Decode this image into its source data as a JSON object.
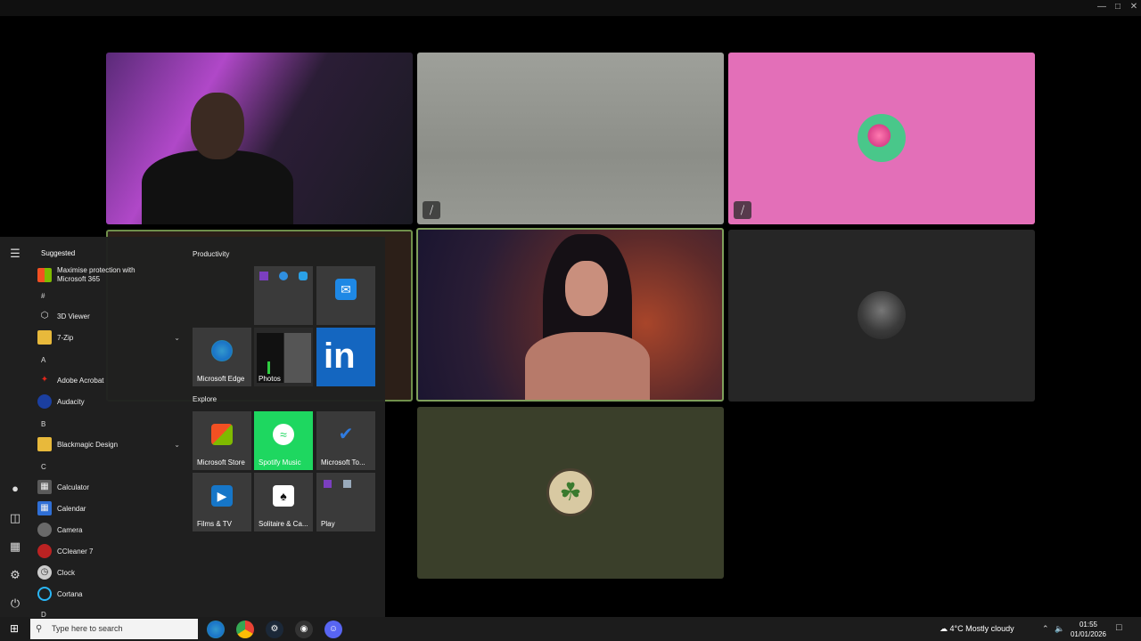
{
  "participants": [
    {
      "id": "p1",
      "muted": false
    },
    {
      "id": "p2",
      "muted": true
    },
    {
      "id": "p3",
      "muted": true
    },
    {
      "id": "p4",
      "muted": false
    },
    {
      "id": "p5",
      "muted": false,
      "active_speaker": true
    },
    {
      "id": "p6",
      "muted": false
    },
    {
      "id": "p7",
      "muted": false
    }
  ],
  "start_menu": {
    "suggested_header": "Suggested",
    "suggested_item": "Maximise protection with Microsoft 365",
    "apps": [
      {
        "group": "#"
      },
      {
        "label": "3D Viewer",
        "icon": "cube-icon"
      },
      {
        "label": "7-Zip",
        "icon": "folder-icon",
        "expandable": true
      },
      {
        "group": "A"
      },
      {
        "label": "Adobe Acrobat",
        "icon": "acrobat-icon"
      },
      {
        "label": "Audacity",
        "icon": "audacity-icon"
      },
      {
        "group": "B"
      },
      {
        "label": "Blackmagic Design",
        "icon": "folder-icon",
        "expandable": true
      },
      {
        "group": "C"
      },
      {
        "label": "Calculator",
        "icon": "calculator-icon"
      },
      {
        "label": "Calendar",
        "icon": "calendar-icon"
      },
      {
        "label": "Camera",
        "icon": "camera-icon"
      },
      {
        "label": "CCleaner 7",
        "icon": "ccleaner-icon"
      },
      {
        "label": "Clock",
        "icon": "clock-icon"
      },
      {
        "label": "Cortana",
        "icon": "cortana-icon"
      },
      {
        "group": "D"
      }
    ],
    "groups": {
      "productivity": "Productivity",
      "explore": "Explore"
    },
    "tiles": {
      "edge": "Microsoft Edge",
      "photos": "Photos",
      "store": "Microsoft Store",
      "spotify": "Spotify Music",
      "todo": "Microsoft To...",
      "films": "Films & TV",
      "solitaire": "Solitaire & Ca...",
      "play": "Play"
    },
    "accent": "#1ed760"
  },
  "taskbar": {
    "search_placeholder": "Type here to search",
    "weather_temp": "4°C",
    "weather_text": "Mostly cloudy",
    "time": "01:55",
    "date": "01/01/2026"
  }
}
